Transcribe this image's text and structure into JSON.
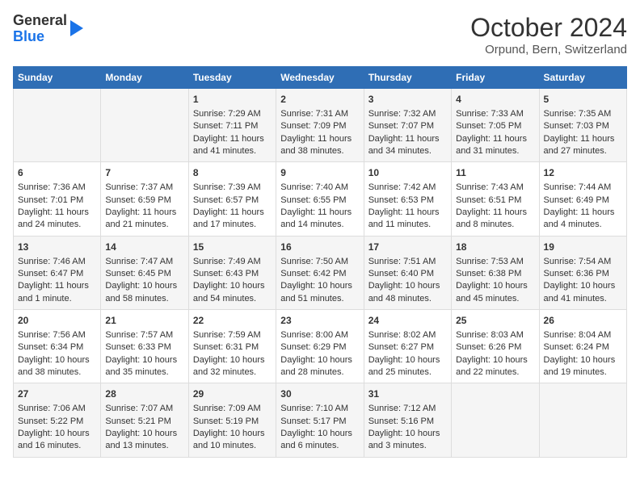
{
  "header": {
    "logo_line1": "General",
    "logo_line2": "Blue",
    "month_year": "October 2024",
    "location": "Orpund, Bern, Switzerland"
  },
  "weekdays": [
    "Sunday",
    "Monday",
    "Tuesday",
    "Wednesday",
    "Thursday",
    "Friday",
    "Saturday"
  ],
  "weeks": [
    [
      {
        "day": "",
        "content": ""
      },
      {
        "day": "",
        "content": ""
      },
      {
        "day": "1",
        "content": "Sunrise: 7:29 AM\nSunset: 7:11 PM\nDaylight: 11 hours and 41 minutes."
      },
      {
        "day": "2",
        "content": "Sunrise: 7:31 AM\nSunset: 7:09 PM\nDaylight: 11 hours and 38 minutes."
      },
      {
        "day": "3",
        "content": "Sunrise: 7:32 AM\nSunset: 7:07 PM\nDaylight: 11 hours and 34 minutes."
      },
      {
        "day": "4",
        "content": "Sunrise: 7:33 AM\nSunset: 7:05 PM\nDaylight: 11 hours and 31 minutes."
      },
      {
        "day": "5",
        "content": "Sunrise: 7:35 AM\nSunset: 7:03 PM\nDaylight: 11 hours and 27 minutes."
      }
    ],
    [
      {
        "day": "6",
        "content": "Sunrise: 7:36 AM\nSunset: 7:01 PM\nDaylight: 11 hours and 24 minutes."
      },
      {
        "day": "7",
        "content": "Sunrise: 7:37 AM\nSunset: 6:59 PM\nDaylight: 11 hours and 21 minutes."
      },
      {
        "day": "8",
        "content": "Sunrise: 7:39 AM\nSunset: 6:57 PM\nDaylight: 11 hours and 17 minutes."
      },
      {
        "day": "9",
        "content": "Sunrise: 7:40 AM\nSunset: 6:55 PM\nDaylight: 11 hours and 14 minutes."
      },
      {
        "day": "10",
        "content": "Sunrise: 7:42 AM\nSunset: 6:53 PM\nDaylight: 11 hours and 11 minutes."
      },
      {
        "day": "11",
        "content": "Sunrise: 7:43 AM\nSunset: 6:51 PM\nDaylight: 11 hours and 8 minutes."
      },
      {
        "day": "12",
        "content": "Sunrise: 7:44 AM\nSunset: 6:49 PM\nDaylight: 11 hours and 4 minutes."
      }
    ],
    [
      {
        "day": "13",
        "content": "Sunrise: 7:46 AM\nSunset: 6:47 PM\nDaylight: 11 hours and 1 minute."
      },
      {
        "day": "14",
        "content": "Sunrise: 7:47 AM\nSunset: 6:45 PM\nDaylight: 10 hours and 58 minutes."
      },
      {
        "day": "15",
        "content": "Sunrise: 7:49 AM\nSunset: 6:43 PM\nDaylight: 10 hours and 54 minutes."
      },
      {
        "day": "16",
        "content": "Sunrise: 7:50 AM\nSunset: 6:42 PM\nDaylight: 10 hours and 51 minutes."
      },
      {
        "day": "17",
        "content": "Sunrise: 7:51 AM\nSunset: 6:40 PM\nDaylight: 10 hours and 48 minutes."
      },
      {
        "day": "18",
        "content": "Sunrise: 7:53 AM\nSunset: 6:38 PM\nDaylight: 10 hours and 45 minutes."
      },
      {
        "day": "19",
        "content": "Sunrise: 7:54 AM\nSunset: 6:36 PM\nDaylight: 10 hours and 41 minutes."
      }
    ],
    [
      {
        "day": "20",
        "content": "Sunrise: 7:56 AM\nSunset: 6:34 PM\nDaylight: 10 hours and 38 minutes."
      },
      {
        "day": "21",
        "content": "Sunrise: 7:57 AM\nSunset: 6:33 PM\nDaylight: 10 hours and 35 minutes."
      },
      {
        "day": "22",
        "content": "Sunrise: 7:59 AM\nSunset: 6:31 PM\nDaylight: 10 hours and 32 minutes."
      },
      {
        "day": "23",
        "content": "Sunrise: 8:00 AM\nSunset: 6:29 PM\nDaylight: 10 hours and 28 minutes."
      },
      {
        "day": "24",
        "content": "Sunrise: 8:02 AM\nSunset: 6:27 PM\nDaylight: 10 hours and 25 minutes."
      },
      {
        "day": "25",
        "content": "Sunrise: 8:03 AM\nSunset: 6:26 PM\nDaylight: 10 hours and 22 minutes."
      },
      {
        "day": "26",
        "content": "Sunrise: 8:04 AM\nSunset: 6:24 PM\nDaylight: 10 hours and 19 minutes."
      }
    ],
    [
      {
        "day": "27",
        "content": "Sunrise: 7:06 AM\nSunset: 5:22 PM\nDaylight: 10 hours and 16 minutes."
      },
      {
        "day": "28",
        "content": "Sunrise: 7:07 AM\nSunset: 5:21 PM\nDaylight: 10 hours and 13 minutes."
      },
      {
        "day": "29",
        "content": "Sunrise: 7:09 AM\nSunset: 5:19 PM\nDaylight: 10 hours and 10 minutes."
      },
      {
        "day": "30",
        "content": "Sunrise: 7:10 AM\nSunset: 5:17 PM\nDaylight: 10 hours and 6 minutes."
      },
      {
        "day": "31",
        "content": "Sunrise: 7:12 AM\nSunset: 5:16 PM\nDaylight: 10 hours and 3 minutes."
      },
      {
        "day": "",
        "content": ""
      },
      {
        "day": "",
        "content": ""
      }
    ]
  ]
}
